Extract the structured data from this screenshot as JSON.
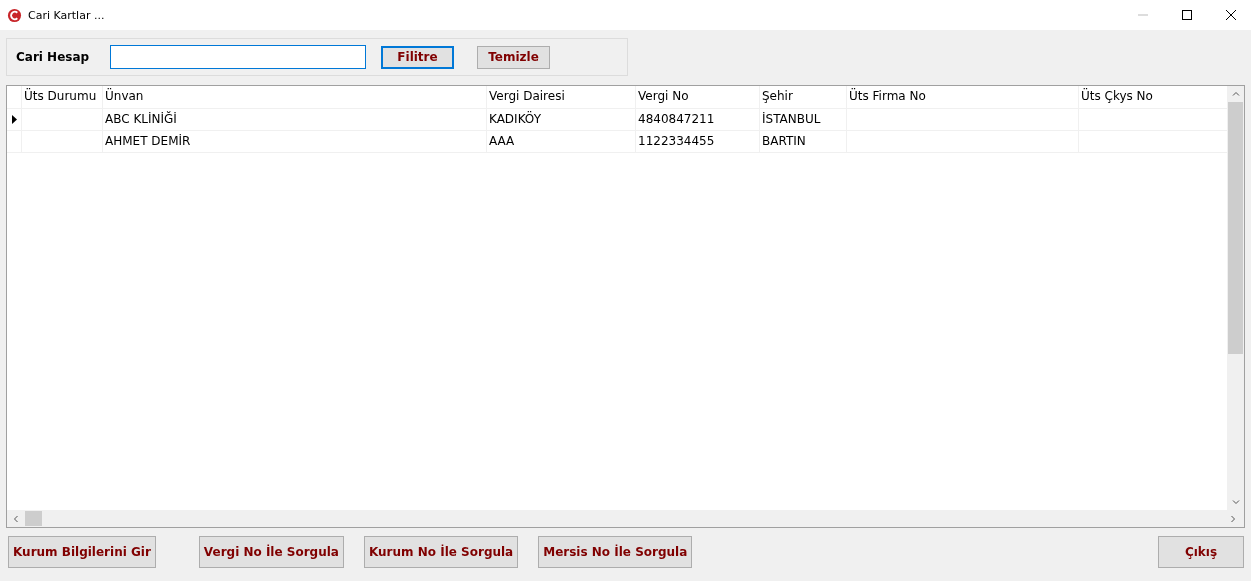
{
  "window": {
    "title": "Cari Kartlar ..."
  },
  "filter": {
    "label": "Cari Hesap",
    "buttons": [
      {
        "label": "Filitre",
        "focused": true
      },
      {
        "label": "Temizle",
        "focused": false
      }
    ]
  },
  "table": {
    "columns": [
      "Üts Durumu",
      "Ünvan",
      "Vergi Dairesi",
      "Vergi No",
      "Şehir",
      "Üts Firma No",
      "Üts Çkys No"
    ],
    "rows": [
      {
        "selected": true,
        "cells": [
          "",
          "ABC KLİNİĞİ",
          "KADIKÖY",
          "4840847211",
          "İSTANBUL",
          "",
          ""
        ]
      },
      {
        "selected": false,
        "cells": [
          "",
          "AHMET DEMİR",
          "AAA",
          "1122334455",
          "BARTIN",
          "",
          ""
        ]
      }
    ]
  },
  "actions": [
    "Kurum Bilgilerini Gir",
    "Vergi No İle Sorgula",
    "Kurum No İle Sorgula",
    "Mersis No İle Sorgula"
  ],
  "exit_button": "Çıkış"
}
